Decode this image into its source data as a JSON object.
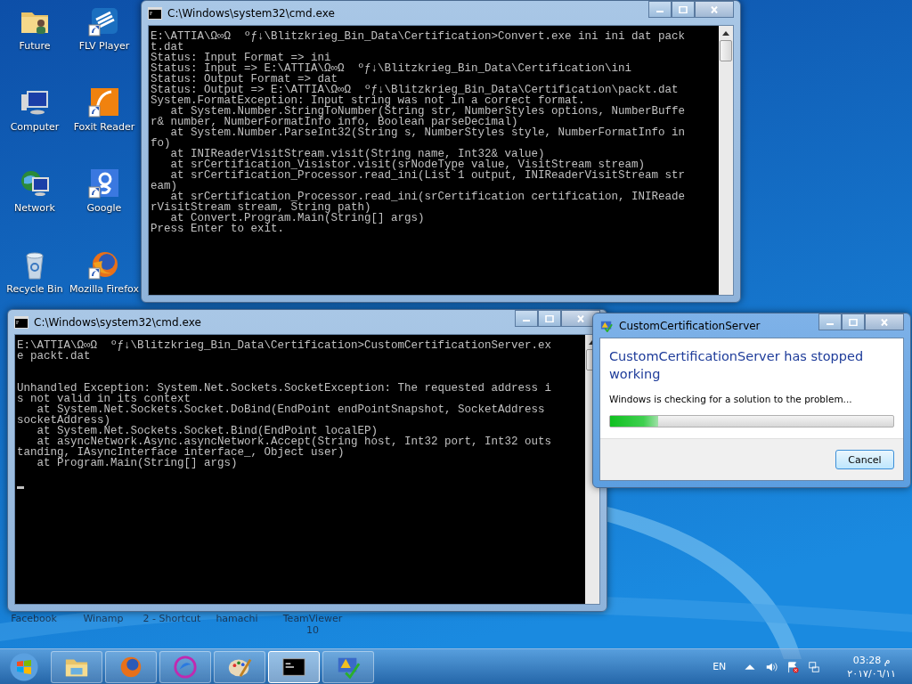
{
  "desktop_icons": [
    {
      "label": "Future",
      "shortcut": false
    },
    {
      "label": "FLV Player",
      "shortcut": true
    },
    {
      "label": "Computer",
      "shortcut": false
    },
    {
      "label": "Foxit Reader",
      "shortcut": true
    },
    {
      "label": "Network",
      "shortcut": false
    },
    {
      "label": "Google",
      "shortcut": true
    },
    {
      "label": "Recycle Bin",
      "shortcut": false
    },
    {
      "label": "Mozilla Firefox",
      "shortcut": true
    }
  ],
  "hidden_icon_labels": [
    "Facebook",
    "Winamp",
    "2 - Shortcut",
    "hamachi",
    "TeamViewer 10"
  ],
  "console_top": {
    "title": "C:\\Windows\\system32\\cmd.exe",
    "blocks": [
      [
        "E:\\ATTIA\\Ω∞Ω  ºƒ↓\\Blitzkrieg_Bin_Data\\Certification>Convert.exe ini ini dat pack",
        "t.dat",
        "Status: Input Format => ini",
        "Status: Input => E:\\ATTIA\\Ω∞Ω  ºƒ↓\\Blitzkrieg_Bin_Data\\Certification\\ini",
        "Status: Output Format => dat",
        "Status: Output => E:\\ATTIA\\Ω∞Ω  ºƒ↓\\Blitzkrieg_Bin_Data\\Certification\\packt.dat",
        "System.FormatException: Input string was not in a correct format.",
        "   at System.Number.StringToNumber(String str, NumberStyles options, NumberBuffe",
        "r& number, NumberFormatInfo info, Boolean parseDecimal)",
        "   at System.Number.ParseInt32(String s, NumberStyles style, NumberFormatInfo in",
        "fo)",
        "   at INIReaderVisitStream.visit(String name, Int32& value)",
        "   at srCertification_Visistor.visit(srNodeType value, VisitStream stream)",
        "   at srCertification_Processor.read_ini(List`1 output, INIReaderVisitStream str",
        "eam)",
        "   at srCertification_Processor.read_ini(srCertification certification, INIReade",
        "rVisitStream stream, String path)",
        "   at Convert.Program.Main(String[] args)",
        "Press Enter to exit."
      ]
    ]
  },
  "console_bottom": {
    "title": "C:\\Windows\\system32\\cmd.exe",
    "blocks": [
      [
        "E:\\ATTIA\\Ω∞Ω  ºƒ↓\\Blitzkrieg_Bin_Data\\Certification>CustomCertificationServer.ex",
        "e packt.dat"
      ],
      [
        "Unhandled Exception: System.Net.Sockets.SocketException: The requested address i",
        "s not valid in its context",
        "   at System.Net.Sockets.Socket.DoBind(EndPoint endPointSnapshot, SocketAddress",
        "socketAddress)",
        "   at System.Net.Sockets.Socket.Bind(EndPoint localEP)",
        "   at asyncNetwork.Async.asyncNetwork.Accept(String host, Int32 port, Int32 outs",
        "tanding, IAsyncInterface interface_, Object user)",
        "   at Program.Main(String[] args)"
      ]
    ],
    "cursor": true
  },
  "error_dialog": {
    "title": "CustomCertificationServer",
    "heading": "CustomCertificationServer has stopped working",
    "message": "Windows is checking for a solution to the problem...",
    "level": 0.17,
    "button": "Cancel"
  },
  "taskbar": {
    "items": [
      {
        "active": false
      },
      {
        "active": false
      },
      {
        "active": false
      },
      {
        "active": false
      },
      {
        "active": true
      },
      {
        "active": false
      }
    ],
    "language": "EN",
    "time": "03:28 م",
    "date": "٢٠١٧/٠٦/١١"
  }
}
